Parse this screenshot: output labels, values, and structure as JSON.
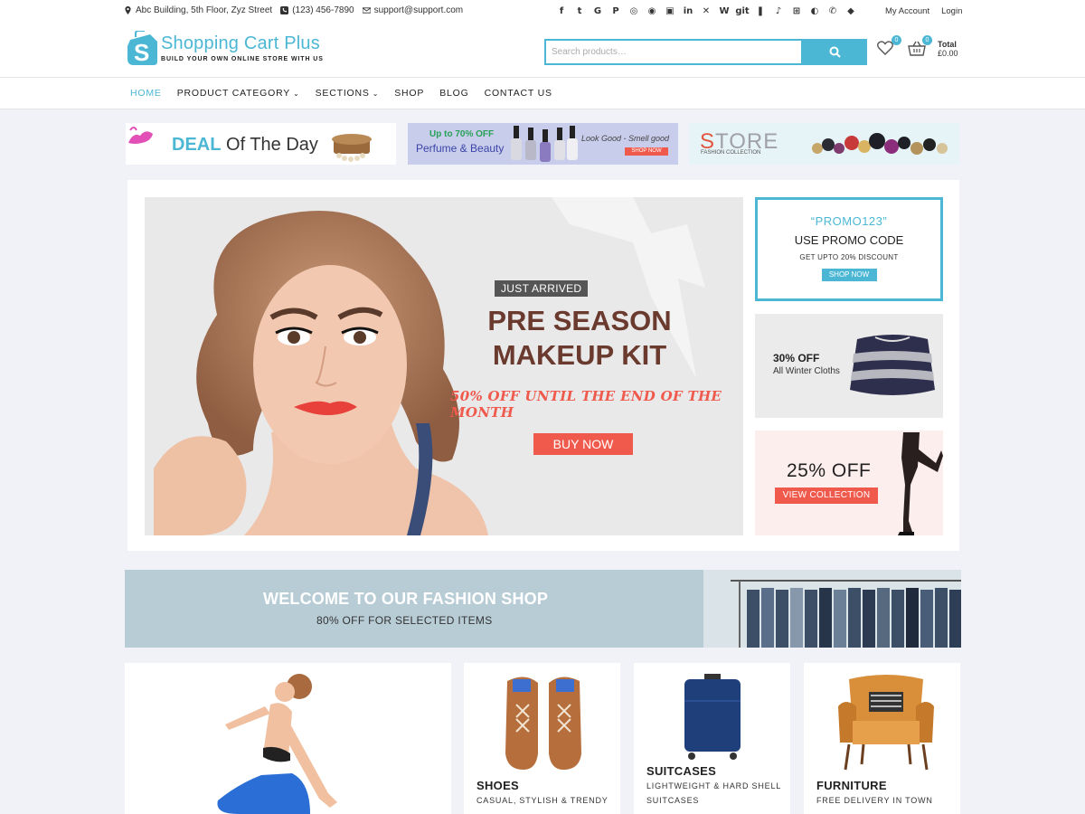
{
  "topbar": {
    "address": "Abc Building, 5th Floor, Zyz Street",
    "phone": "(123) 456-7890",
    "email": "support@support.com",
    "social": [
      "f",
      "t",
      "G",
      "P",
      "◎",
      "◉",
      "▣",
      "in",
      "✕",
      "W",
      "git",
      "❚",
      "♪",
      "⊞",
      "◐",
      "✆",
      "◆"
    ],
    "my_account": "My Account",
    "login": "Login"
  },
  "header": {
    "logo_title": "Shopping Cart Plus",
    "logo_tagline": "BUILD YOUR OWN ONLINE STORE WITH US",
    "search_placeholder": "Search products…",
    "wishlist_count": "0",
    "cart_count": "0",
    "total_label": "Total",
    "total_value": "£0.00"
  },
  "nav": {
    "items": [
      "HOME",
      "PRODUCT CATEGORY",
      "SECTIONS",
      "SHOP",
      "BLOG",
      "CONTACT US"
    ]
  },
  "strips": {
    "deal_prefix": "DEAL",
    "deal_suffix": "Of The Day",
    "perfume_top": "Up to 70% OFF",
    "perfume_bottom": "Perfume & Beauty",
    "perfume_tag": "Look Good - Smell good",
    "perfume_btn": "SHOP NOW",
    "store_first": "S",
    "store_rest": "TORE",
    "store_sub": "FASHION COLLECTION"
  },
  "hero": {
    "badge": "JUST ARRIVED",
    "title_line1": "PRE SEASON",
    "title_line2": "MAKEUP KIT",
    "offer": "50% OFF UNTIL THE END OF THE MONTH",
    "cta": "BUY NOW"
  },
  "side": {
    "promo_code": "“PROMO123”",
    "promo_title": "USE PROMO CODE",
    "promo_sub": "GET UPTO 20% DISCOUNT",
    "promo_btn": "SHOP NOW",
    "winter_off": "30% OFF",
    "winter_sub": "All Winter Cloths",
    "collection_off": "25% OFF",
    "collection_btn": "VIEW COLLECTION"
  },
  "welcome": {
    "title": "WELCOME TO OUR FASHION SHOP",
    "sub": "80% OFF FOR SELECTED ITEMS"
  },
  "categories": [
    {
      "title": "SHOES",
      "sub1": "CASUAL, STYLISH & TRENDY",
      "sub2": ""
    },
    {
      "title": "SUITCASES",
      "sub1": "LIGHTWEIGHT & HARD SHELL",
      "sub2": "SUITCASES"
    },
    {
      "title": "FURNITURE",
      "sub1": "FREE DELIVERY IN TOWN",
      "sub2": ""
    }
  ],
  "colors": {
    "accent": "#4bb7d4",
    "hero_title": "#6b3a2e",
    "cta": "#ef5a4d",
    "page_bg": "#f0f2f8"
  }
}
